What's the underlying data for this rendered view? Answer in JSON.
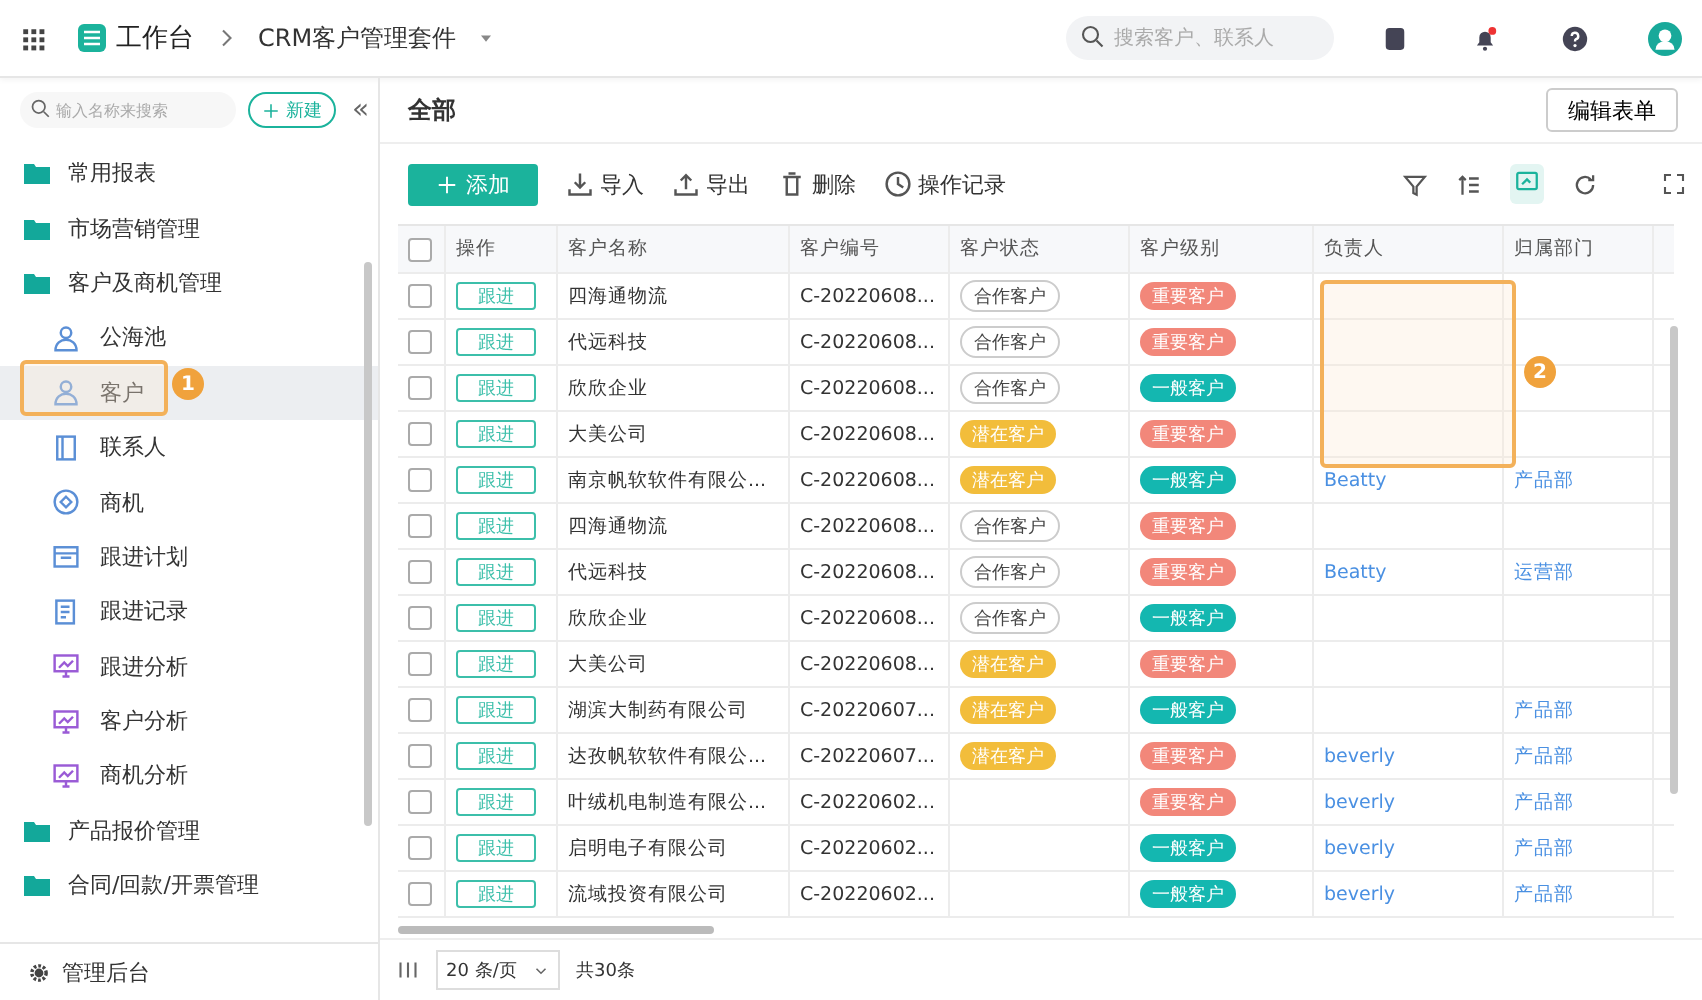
{
  "topbar": {
    "workspace": "工作台",
    "app": "CRM客户管理套件",
    "search": {
      "placeholder": "搜索客户、联系人"
    }
  },
  "sidebar": {
    "search": {
      "placeholder": "输入名称来搜索"
    },
    "new_button": "新建",
    "collapse": "«",
    "items": [
      {
        "label": "常用报表",
        "kind": "folder",
        "selected": false
      },
      {
        "label": "市场营销管理",
        "kind": "folder",
        "selected": false
      },
      {
        "label": "客户及商机管理",
        "kind": "folder",
        "selected": false,
        "children": [
          {
            "label": "公海池",
            "kind": "person",
            "selected": false
          },
          {
            "label": "客户",
            "kind": "person",
            "selected": true
          },
          {
            "label": "联系人",
            "kind": "book",
            "selected": false
          },
          {
            "label": "商机",
            "kind": "target",
            "selected": false
          },
          {
            "label": "跟进计划",
            "kind": "calendar",
            "selected": false
          },
          {
            "label": "跟进记录",
            "kind": "doc",
            "selected": false
          },
          {
            "label": "跟进分析",
            "kind": "chart",
            "selected": false
          },
          {
            "label": "客户分析",
            "kind": "chart",
            "selected": false
          },
          {
            "label": "商机分析",
            "kind": "chart",
            "selected": false
          }
        ]
      },
      {
        "label": "产品报价管理",
        "kind": "folder",
        "selected": false
      },
      {
        "label": "合同/回款/开票管理",
        "kind": "folder",
        "selected": false
      }
    ],
    "footer": "管理后台"
  },
  "header": {
    "title": "全部",
    "edit_button": "编辑表单"
  },
  "toolbar": {
    "add_button": "添加",
    "actions": [
      {
        "label": "导入",
        "kind": "import"
      },
      {
        "label": "导出",
        "kind": "export"
      },
      {
        "label": "删除",
        "kind": "delete"
      },
      {
        "label": "操作记录",
        "kind": "history"
      }
    ]
  },
  "table": {
    "all_checked": false,
    "columns": [
      "操作",
      "客户名称",
      "客户编号",
      "客户状态",
      "客户级别",
      "负责人",
      "归属部门"
    ],
    "rows": [
      {
        "checked": false,
        "action": "跟进",
        "name": "四海通物流",
        "code": "C-20220608...",
        "status": {
          "text": "合作客户",
          "kind": "cooperating"
        },
        "level": {
          "text": "重要客户",
          "kind": "important"
        }
      },
      {
        "checked": false,
        "action": "跟进",
        "name": "代远科技",
        "code": "C-20220608...",
        "status": {
          "text": "合作客户",
          "kind": "cooperating"
        },
        "level": {
          "text": "重要客户",
          "kind": "important"
        }
      },
      {
        "checked": false,
        "action": "跟进",
        "name": "欣欣企业",
        "code": "C-20220608...",
        "status": {
          "text": "合作客户",
          "kind": "cooperating"
        },
        "level": {
          "text": "一般客户",
          "kind": "normal"
        }
      },
      {
        "checked": false,
        "action": "跟进",
        "name": "大美公司",
        "code": "C-20220608...",
        "status": {
          "text": "潜在客户",
          "kind": "potential"
        },
        "level": {
          "text": "重要客户",
          "kind": "important"
        }
      },
      {
        "checked": false,
        "action": "跟进",
        "name": "南京帆软软件有限公...",
        "code": "C-20220608...",
        "status": {
          "text": "潜在客户",
          "kind": "potential"
        },
        "level": {
          "text": "一般客户",
          "kind": "normal"
        },
        "owner": "Beatty",
        "department": "产品部"
      },
      {
        "checked": false,
        "action": "跟进",
        "name": "四海通物流",
        "code": "C-20220608...",
        "status": {
          "text": "合作客户",
          "kind": "cooperating"
        },
        "level": {
          "text": "重要客户",
          "kind": "important"
        }
      },
      {
        "checked": false,
        "action": "跟进",
        "name": "代远科技",
        "code": "C-20220608...",
        "status": {
          "text": "合作客户",
          "kind": "cooperating"
        },
        "level": {
          "text": "重要客户",
          "kind": "important"
        },
        "owner": "Beatty",
        "department": "运营部"
      },
      {
        "checked": false,
        "action": "跟进",
        "name": "欣欣企业",
        "code": "C-20220608...",
        "status": {
          "text": "合作客户",
          "kind": "cooperating"
        },
        "level": {
          "text": "一般客户",
          "kind": "normal"
        }
      },
      {
        "checked": false,
        "action": "跟进",
        "name": "大美公司",
        "code": "C-20220608...",
        "status": {
          "text": "潜在客户",
          "kind": "potential"
        },
        "level": {
          "text": "重要客户",
          "kind": "important"
        }
      },
      {
        "checked": false,
        "action": "跟进",
        "name": "湖滨大制药有限公司",
        "code": "C-20220607...",
        "status": {
          "text": "潜在客户",
          "kind": "potential"
        },
        "level": {
          "text": "一般客户",
          "kind": "normal"
        },
        "department": "产品部"
      },
      {
        "checked": false,
        "action": "跟进",
        "name": "达孜帆软软件有限公...",
        "code": "C-20220607...",
        "status": {
          "text": "潜在客户",
          "kind": "potential"
        },
        "level": {
          "text": "重要客户",
          "kind": "important"
        },
        "owner": "beverly",
        "department": "产品部"
      },
      {
        "checked": false,
        "action": "跟进",
        "name": "叶绒机电制造有限公...",
        "code": "C-20220602...",
        "level": {
          "text": "重要客户",
          "kind": "important"
        },
        "owner": "beverly",
        "department": "产品部"
      },
      {
        "checked": false,
        "action": "跟进",
        "name": "启明电子有限公司",
        "code": "C-20220602...",
        "level": {
          "text": "一般客户",
          "kind": "normal"
        },
        "owner": "beverly",
        "department": "产品部"
      },
      {
        "checked": false,
        "action": "跟进",
        "name": "流域投资有限公司",
        "code": "C-20220602...",
        "level": {
          "text": "一般客户",
          "kind": "normal"
        },
        "owner": "beverly",
        "department": "产品部"
      }
    ]
  },
  "pagination": {
    "page_size": "20 条/页",
    "total": "共30条"
  },
  "annotations": [
    {
      "label": "1"
    },
    {
      "label": "2"
    }
  ]
}
